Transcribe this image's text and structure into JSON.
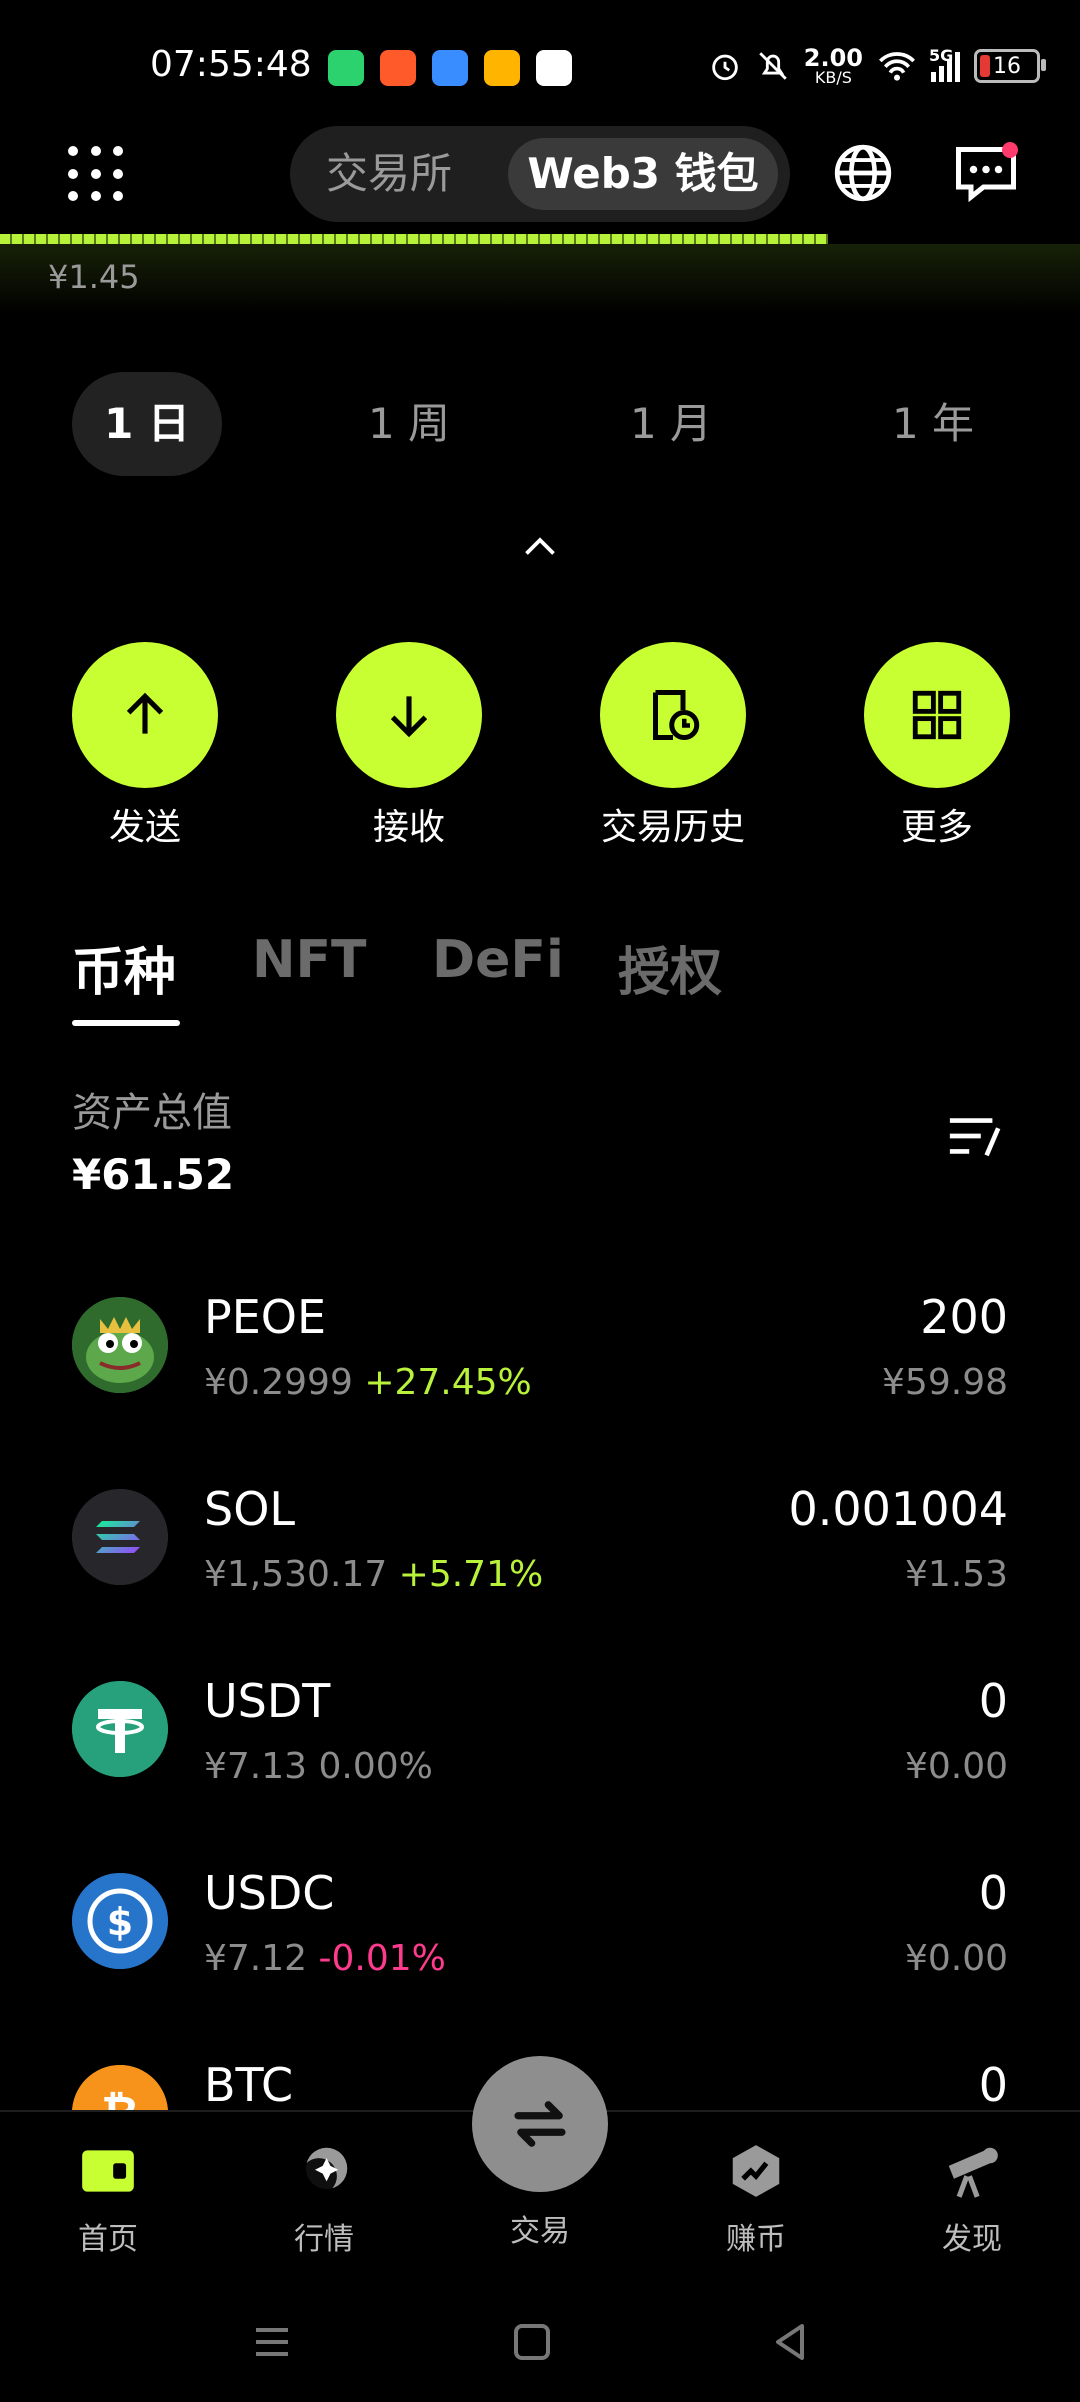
{
  "status": {
    "time": "07:55:48",
    "net_speed_value": "2.00",
    "net_speed_unit": "KB/S",
    "net_type": "5G",
    "battery": "16",
    "apps": [
      {
        "name": "app1",
        "color": "#2bd26e"
      },
      {
        "name": "app2",
        "color": "#ff5a2a"
      },
      {
        "name": "app3",
        "color": "#3a8dff"
      },
      {
        "name": "app4",
        "color": "#ffb400"
      },
      {
        "name": "app5",
        "color": "#ff4444"
      }
    ]
  },
  "header": {
    "tab_exchange": "交易所",
    "tab_web3": "Web3 钱包"
  },
  "chart": {
    "min_label": "¥1.45"
  },
  "timeframes": [
    "1 日",
    "1 周",
    "1 月",
    "1 年"
  ],
  "actions": [
    {
      "label": "发送",
      "icon": "arrow-up-icon"
    },
    {
      "label": "接收",
      "icon": "arrow-down-icon"
    },
    {
      "label": "交易历史",
      "icon": "history-icon"
    },
    {
      "label": "更多",
      "icon": "grid-icon"
    }
  ],
  "tabs": [
    "币种",
    "NFT",
    "DeFi",
    "授权"
  ],
  "total": {
    "label": "资产总值",
    "value": "¥61.52"
  },
  "tokens": [
    {
      "symbol": "PEOE",
      "price": "¥0.2999",
      "change": "+27.45%",
      "change_color": "green",
      "amount": "200",
      "value": "¥59.98"
    },
    {
      "symbol": "SOL",
      "price": "¥1,530.17",
      "change": "+5.71%",
      "change_color": "green",
      "amount": "0.001004",
      "value": "¥1.53"
    },
    {
      "symbol": "USDT",
      "price": "¥7.13",
      "change": "0.00%",
      "change_color": "gray",
      "amount": "0",
      "value": "¥0.00"
    },
    {
      "symbol": "USDC",
      "price": "¥7.12",
      "change": "-0.01%",
      "change_color": "pink",
      "amount": "0",
      "value": "¥0.00"
    },
    {
      "symbol": "BTC",
      "price": "",
      "change": "",
      "change_color": "gray",
      "amount": "0",
      "value": ""
    }
  ],
  "bottom_nav": [
    "首页",
    "行情",
    "交易",
    "赚币",
    "发现"
  ],
  "colors": {
    "accent": "#c8ff33",
    "positive": "#b9f23a",
    "negative": "#ff3b8d"
  }
}
